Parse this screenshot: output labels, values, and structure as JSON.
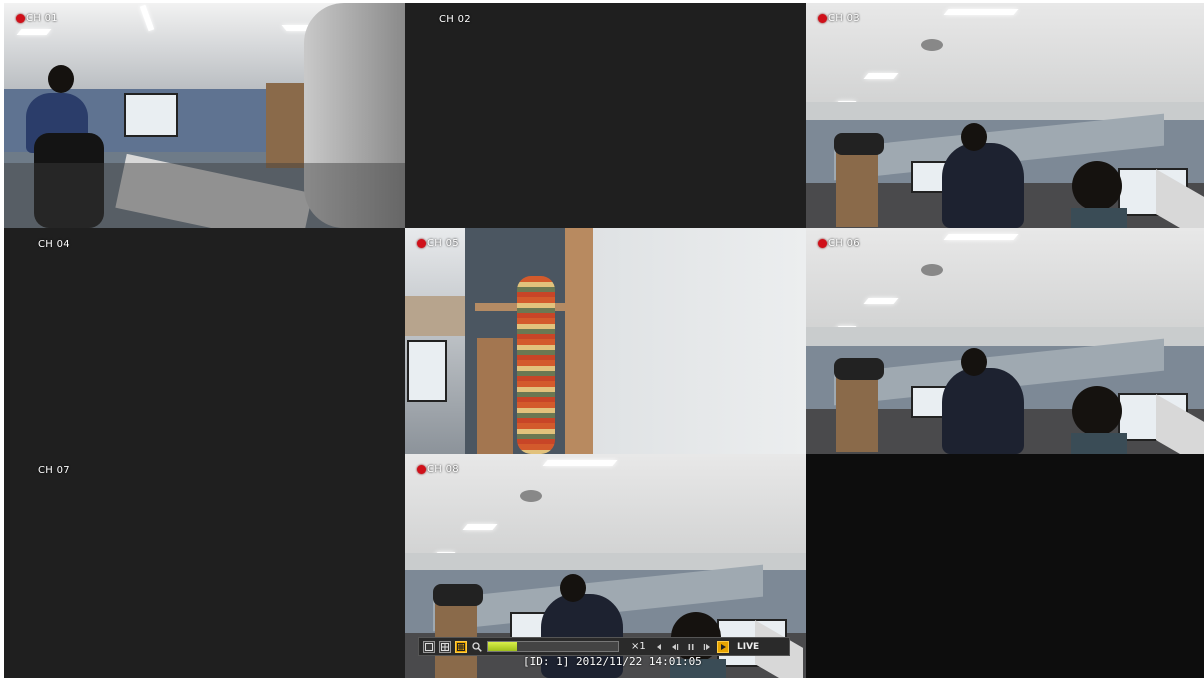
{
  "channels": [
    {
      "label": "CH 01",
      "recording": true,
      "night_mode_icon": "moon-icon"
    },
    {
      "label": "CH 02",
      "recording": false
    },
    {
      "label": "CH 03",
      "recording": true
    },
    {
      "label": "CH 04",
      "recording": false
    },
    {
      "label": "CH 05",
      "recording": true
    },
    {
      "label": "CH 06",
      "recording": true
    },
    {
      "label": "CH 07",
      "recording": false
    },
    {
      "label": "CH 08",
      "recording": true
    }
  ],
  "playback_bar": {
    "layout_buttons": [
      "single-view-icon",
      "quad-view-icon",
      "nine-view-icon"
    ],
    "zoom_icon": "magnifier-icon",
    "speed": "×1",
    "progress": 0.22,
    "transport_icons": [
      "step-back-icon",
      "rewind-icon",
      "pause-icon",
      "forward-icon",
      "play-icon"
    ],
    "live_label": "LIVE"
  },
  "status": {
    "timestamp": "[ID: 1] 2012/11/22 14:01:05"
  },
  "colors": {
    "rec_dot": "#d0101a",
    "active_button": "#e8a400",
    "no_signal": "#1f1f1f"
  }
}
